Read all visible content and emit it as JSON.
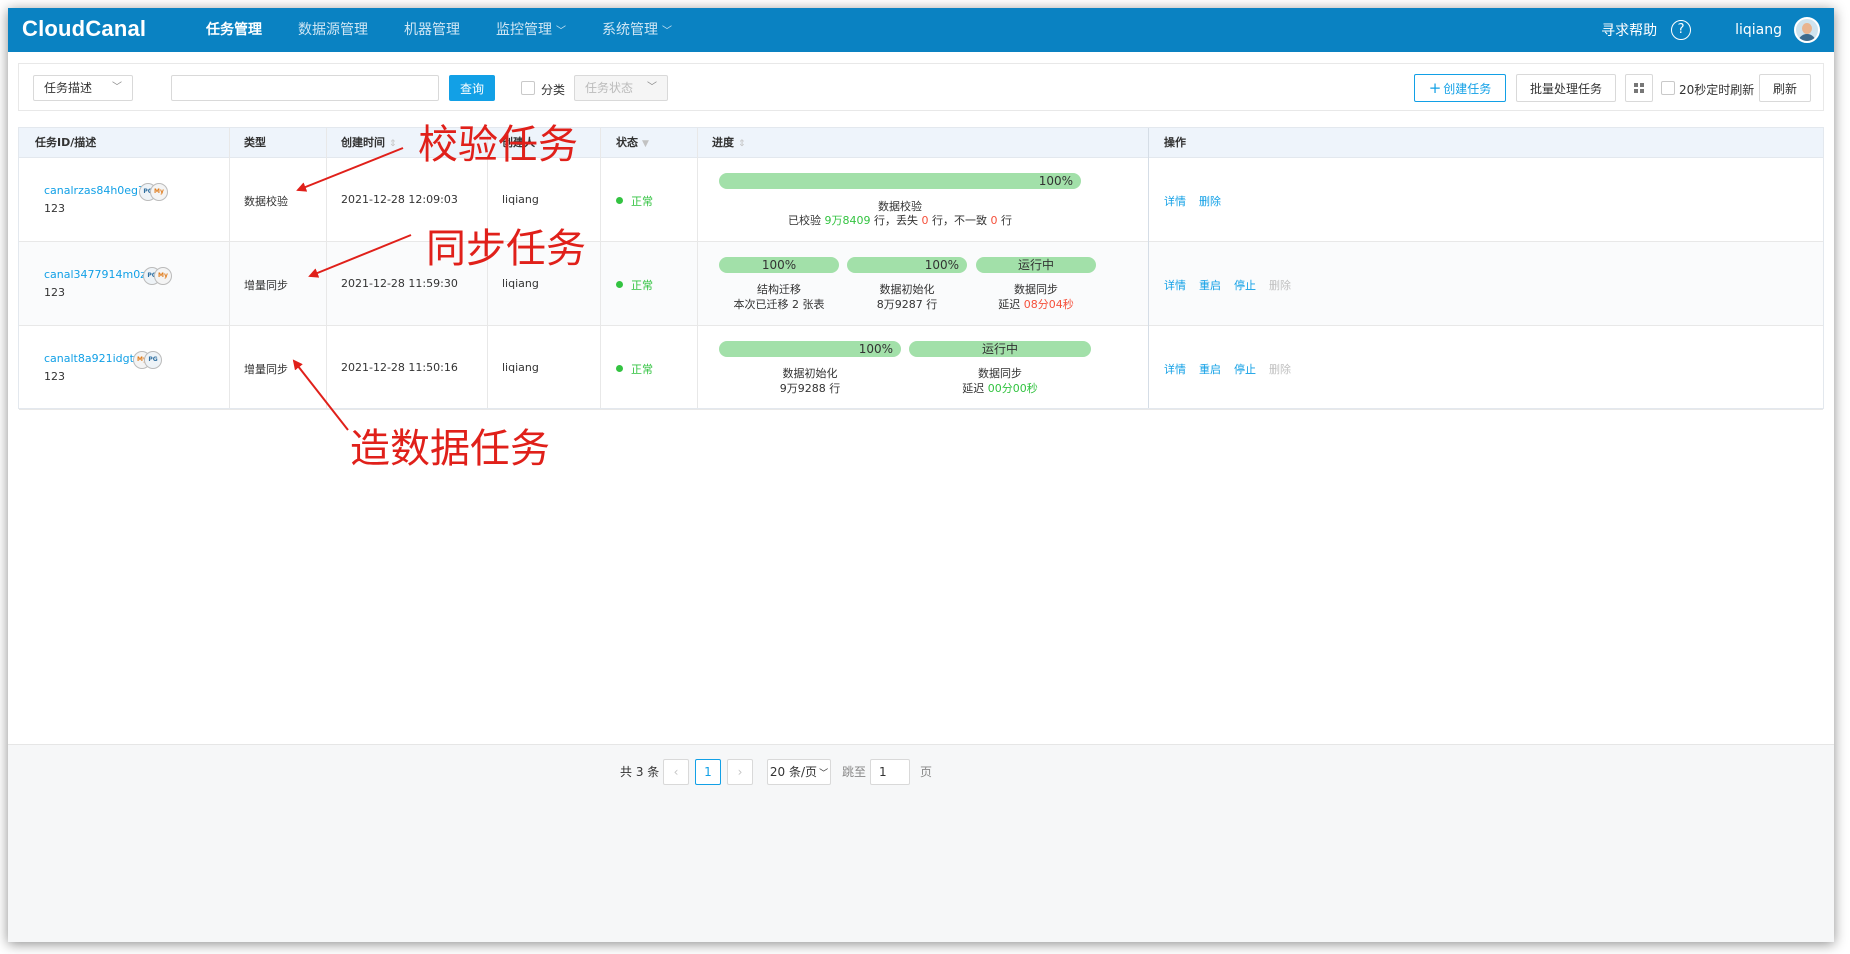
{
  "app": {
    "logo": "CloudCanal"
  },
  "nav": [
    {
      "label": "任务管理",
      "active": true,
      "dropdown": false
    },
    {
      "label": "数据源管理",
      "active": false,
      "dropdown": false
    },
    {
      "label": "机器管理",
      "active": false,
      "dropdown": false
    },
    {
      "label": "监控管理",
      "active": false,
      "dropdown": true
    },
    {
      "label": "系统管理",
      "active": false,
      "dropdown": true
    }
  ],
  "header": {
    "help": "寻求帮助",
    "help_icon": "?",
    "user": "liqiang"
  },
  "toolbar": {
    "filter_select": "任务描述",
    "search_value": "",
    "query": "查询",
    "category_label": "分类",
    "status_select": "任务状态",
    "create": "创建任务",
    "batch": "批量处理任务",
    "auto_refresh": "20秒定时刷新",
    "refresh": "刷新"
  },
  "table": {
    "columns": [
      "任务ID/描述",
      "类型",
      "创建时间",
      "创建人",
      "状态",
      "进度",
      "操作"
    ],
    "rows": [
      {
        "id": "canalrzas84h0eg7",
        "desc": "123",
        "type": "数据校验",
        "created": "2021-12-28 12:09:03",
        "creator": "liqiang",
        "status": "正常",
        "progress": {
          "bars": [
            {
              "label": "100%",
              "value": 100
            }
          ],
          "title": "数据校验",
          "detail": {
            "a": "已校验 ",
            "b": "9万8409",
            "c": " 行，丢失 ",
            "d": "0",
            "e": " 行，不一致 ",
            "f": "0",
            "g": " 行"
          }
        },
        "actions": [
          {
            "label": "详情",
            "enabled": true
          },
          {
            "label": "删除",
            "enabled": true
          }
        ]
      },
      {
        "id": "canal3477914m0z3",
        "desc": "123",
        "type": "增量同步",
        "created": "2021-12-28 11:59:30",
        "creator": "liqiang",
        "status": "正常",
        "progress": {
          "bars": [
            {
              "label": "100%",
              "value": 100
            },
            {
              "label": "100%",
              "value": 100
            },
            {
              "label": "运行中",
              "value": 100
            }
          ],
          "stages": [
            {
              "title": "结构迁移",
              "detail": "本次已迁移 2 张表"
            },
            {
              "title": "数据初始化",
              "detail": "8万9287 行"
            },
            {
              "title": "数据同步",
              "detail_prefix": "延迟 ",
              "detail_value": "08分04秒"
            }
          ]
        },
        "actions": [
          {
            "label": "详情",
            "enabled": true
          },
          {
            "label": "重启",
            "enabled": true
          },
          {
            "label": "停止",
            "enabled": true
          },
          {
            "label": "删除",
            "enabled": false
          }
        ]
      },
      {
        "id": "canalt8a921idgt5",
        "desc": "123",
        "type": "增量同步",
        "created": "2021-12-28 11:50:16",
        "creator": "liqiang",
        "status": "正常",
        "progress": {
          "bars": [
            {
              "label": "100%",
              "value": 100
            },
            {
              "label": "运行中",
              "value": 100
            }
          ],
          "stages": [
            {
              "title": "数据初始化",
              "detail": "9万9288 行"
            },
            {
              "title": "数据同步",
              "detail_prefix": "延迟 ",
              "detail_value": "00分00秒"
            }
          ]
        },
        "actions": [
          {
            "label": "详情",
            "enabled": true
          },
          {
            "label": "重启",
            "enabled": true
          },
          {
            "label": "停止",
            "enabled": true
          },
          {
            "label": "删除",
            "enabled": false
          }
        ]
      }
    ]
  },
  "annotations": {
    "verify": "校验任务",
    "sync": "同步任务",
    "make_data": "造数据任务"
  },
  "pagination": {
    "total": "共 3 条",
    "prev": "‹",
    "page": "1",
    "next": "›",
    "page_size": "20 条/页",
    "jump_label": "跳至",
    "jump_value": "1",
    "page_unit": "页"
  },
  "colors": {
    "header": "#0a82c2",
    "primary": "#12a0e6",
    "progress": "#a2e0a9",
    "ok": "#33c341",
    "warn": "#f5503b",
    "annotation": "#e0201a"
  },
  "icons": {
    "db_source": "mysql-icon",
    "db_target": "postgresql-icon"
  }
}
